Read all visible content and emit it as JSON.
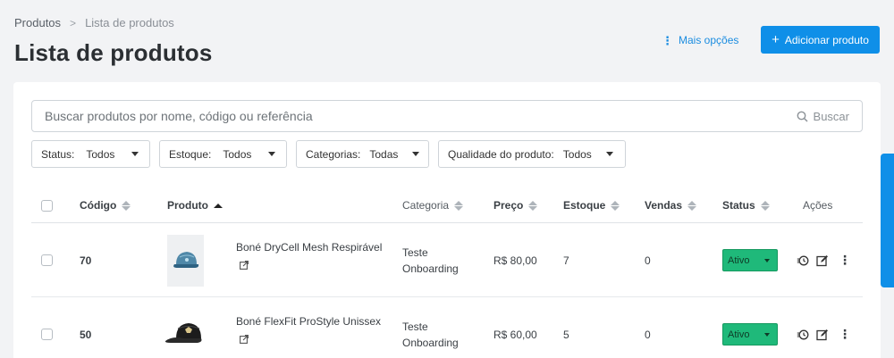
{
  "breadcrumb": {
    "root": "Produtos",
    "separator": ">",
    "current": "Lista de produtos"
  },
  "page": {
    "title": "Lista de produtos"
  },
  "header": {
    "more_options": "Mais opções",
    "add_product": "Adicionar produto"
  },
  "search": {
    "placeholder": "Buscar produtos por nome, código ou referência",
    "button": "Buscar"
  },
  "filters": [
    {
      "label": "Status:",
      "value": "Todos"
    },
    {
      "label": "Estoque:",
      "value": "Todos"
    },
    {
      "label": "Categorias:",
      "value": "Todas"
    },
    {
      "label": "Qualidade do produto:",
      "value": "Todos"
    }
  ],
  "table": {
    "columns": [
      "Código",
      "Produto",
      "Categoria",
      "Preço",
      "Estoque",
      "Vendas",
      "Status",
      "Ações"
    ],
    "rows": [
      {
        "code": "70",
        "product": "Boné DryCell Mesh Respirável",
        "category_line1": "Teste",
        "category_line2": "Onboarding",
        "price": "R$ 80,00",
        "stock": "7",
        "sales": "0",
        "status": "Ativo"
      },
      {
        "code": "50",
        "product": "Boné FlexFit ProStyle Unissex",
        "category_line1": "Teste",
        "category_line2": "Onboarding",
        "price": "R$ 60,00",
        "stock": "5",
        "sales": "0",
        "status": "Ativo"
      }
    ]
  },
  "colors": {
    "primary": "#0f8fe8",
    "status_active": "#1fb97a",
    "background": "#f2f3f5"
  }
}
